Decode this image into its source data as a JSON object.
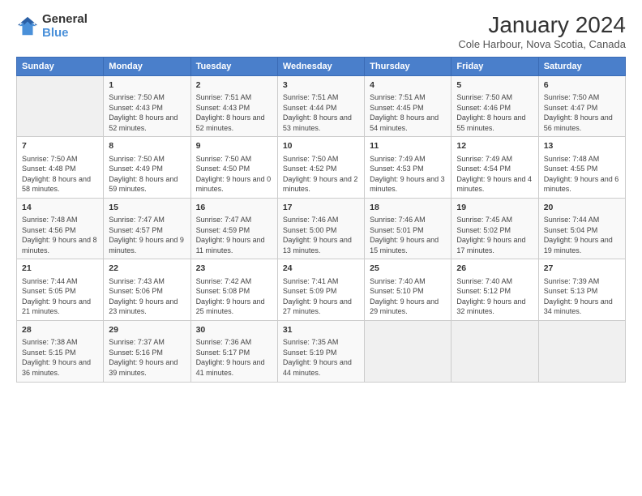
{
  "header": {
    "logo_line1": "General",
    "logo_line2": "Blue",
    "title": "January 2024",
    "subtitle": "Cole Harbour, Nova Scotia, Canada"
  },
  "days_of_week": [
    "Sunday",
    "Monday",
    "Tuesday",
    "Wednesday",
    "Thursday",
    "Friday",
    "Saturday"
  ],
  "weeks": [
    [
      {
        "num": "",
        "empty": true
      },
      {
        "num": "1",
        "sunrise": "Sunrise: 7:50 AM",
        "sunset": "Sunset: 4:43 PM",
        "daylight": "Daylight: 8 hours and 52 minutes."
      },
      {
        "num": "2",
        "sunrise": "Sunrise: 7:51 AM",
        "sunset": "Sunset: 4:43 PM",
        "daylight": "Daylight: 8 hours and 52 minutes."
      },
      {
        "num": "3",
        "sunrise": "Sunrise: 7:51 AM",
        "sunset": "Sunset: 4:44 PM",
        "daylight": "Daylight: 8 hours and 53 minutes."
      },
      {
        "num": "4",
        "sunrise": "Sunrise: 7:51 AM",
        "sunset": "Sunset: 4:45 PM",
        "daylight": "Daylight: 8 hours and 54 minutes."
      },
      {
        "num": "5",
        "sunrise": "Sunrise: 7:50 AM",
        "sunset": "Sunset: 4:46 PM",
        "daylight": "Daylight: 8 hours and 55 minutes."
      },
      {
        "num": "6",
        "sunrise": "Sunrise: 7:50 AM",
        "sunset": "Sunset: 4:47 PM",
        "daylight": "Daylight: 8 hours and 56 minutes."
      }
    ],
    [
      {
        "num": "7",
        "sunrise": "Sunrise: 7:50 AM",
        "sunset": "Sunset: 4:48 PM",
        "daylight": "Daylight: 8 hours and 58 minutes."
      },
      {
        "num": "8",
        "sunrise": "Sunrise: 7:50 AM",
        "sunset": "Sunset: 4:49 PM",
        "daylight": "Daylight: 8 hours and 59 minutes."
      },
      {
        "num": "9",
        "sunrise": "Sunrise: 7:50 AM",
        "sunset": "Sunset: 4:50 PM",
        "daylight": "Daylight: 9 hours and 0 minutes."
      },
      {
        "num": "10",
        "sunrise": "Sunrise: 7:50 AM",
        "sunset": "Sunset: 4:52 PM",
        "daylight": "Daylight: 9 hours and 2 minutes."
      },
      {
        "num": "11",
        "sunrise": "Sunrise: 7:49 AM",
        "sunset": "Sunset: 4:53 PM",
        "daylight": "Daylight: 9 hours and 3 minutes."
      },
      {
        "num": "12",
        "sunrise": "Sunrise: 7:49 AM",
        "sunset": "Sunset: 4:54 PM",
        "daylight": "Daylight: 9 hours and 4 minutes."
      },
      {
        "num": "13",
        "sunrise": "Sunrise: 7:48 AM",
        "sunset": "Sunset: 4:55 PM",
        "daylight": "Daylight: 9 hours and 6 minutes."
      }
    ],
    [
      {
        "num": "14",
        "sunrise": "Sunrise: 7:48 AM",
        "sunset": "Sunset: 4:56 PM",
        "daylight": "Daylight: 9 hours and 8 minutes."
      },
      {
        "num": "15",
        "sunrise": "Sunrise: 7:47 AM",
        "sunset": "Sunset: 4:57 PM",
        "daylight": "Daylight: 9 hours and 9 minutes."
      },
      {
        "num": "16",
        "sunrise": "Sunrise: 7:47 AM",
        "sunset": "Sunset: 4:59 PM",
        "daylight": "Daylight: 9 hours and 11 minutes."
      },
      {
        "num": "17",
        "sunrise": "Sunrise: 7:46 AM",
        "sunset": "Sunset: 5:00 PM",
        "daylight": "Daylight: 9 hours and 13 minutes."
      },
      {
        "num": "18",
        "sunrise": "Sunrise: 7:46 AM",
        "sunset": "Sunset: 5:01 PM",
        "daylight": "Daylight: 9 hours and 15 minutes."
      },
      {
        "num": "19",
        "sunrise": "Sunrise: 7:45 AM",
        "sunset": "Sunset: 5:02 PM",
        "daylight": "Daylight: 9 hours and 17 minutes."
      },
      {
        "num": "20",
        "sunrise": "Sunrise: 7:44 AM",
        "sunset": "Sunset: 5:04 PM",
        "daylight": "Daylight: 9 hours and 19 minutes."
      }
    ],
    [
      {
        "num": "21",
        "sunrise": "Sunrise: 7:44 AM",
        "sunset": "Sunset: 5:05 PM",
        "daylight": "Daylight: 9 hours and 21 minutes."
      },
      {
        "num": "22",
        "sunrise": "Sunrise: 7:43 AM",
        "sunset": "Sunset: 5:06 PM",
        "daylight": "Daylight: 9 hours and 23 minutes."
      },
      {
        "num": "23",
        "sunrise": "Sunrise: 7:42 AM",
        "sunset": "Sunset: 5:08 PM",
        "daylight": "Daylight: 9 hours and 25 minutes."
      },
      {
        "num": "24",
        "sunrise": "Sunrise: 7:41 AM",
        "sunset": "Sunset: 5:09 PM",
        "daylight": "Daylight: 9 hours and 27 minutes."
      },
      {
        "num": "25",
        "sunrise": "Sunrise: 7:40 AM",
        "sunset": "Sunset: 5:10 PM",
        "daylight": "Daylight: 9 hours and 29 minutes."
      },
      {
        "num": "26",
        "sunrise": "Sunrise: 7:40 AM",
        "sunset": "Sunset: 5:12 PM",
        "daylight": "Daylight: 9 hours and 32 minutes."
      },
      {
        "num": "27",
        "sunrise": "Sunrise: 7:39 AM",
        "sunset": "Sunset: 5:13 PM",
        "daylight": "Daylight: 9 hours and 34 minutes."
      }
    ],
    [
      {
        "num": "28",
        "sunrise": "Sunrise: 7:38 AM",
        "sunset": "Sunset: 5:15 PM",
        "daylight": "Daylight: 9 hours and 36 minutes."
      },
      {
        "num": "29",
        "sunrise": "Sunrise: 7:37 AM",
        "sunset": "Sunset: 5:16 PM",
        "daylight": "Daylight: 9 hours and 39 minutes."
      },
      {
        "num": "30",
        "sunrise": "Sunrise: 7:36 AM",
        "sunset": "Sunset: 5:17 PM",
        "daylight": "Daylight: 9 hours and 41 minutes."
      },
      {
        "num": "31",
        "sunrise": "Sunrise: 7:35 AM",
        "sunset": "Sunset: 5:19 PM",
        "daylight": "Daylight: 9 hours and 44 minutes."
      },
      {
        "num": "",
        "empty": true
      },
      {
        "num": "",
        "empty": true
      },
      {
        "num": "",
        "empty": true
      }
    ]
  ]
}
